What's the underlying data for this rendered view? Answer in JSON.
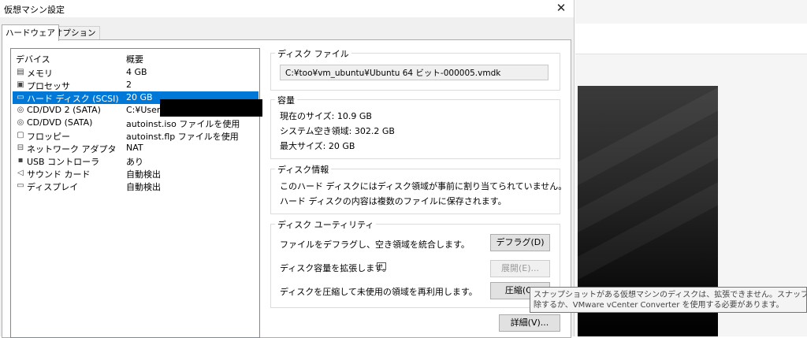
{
  "window": {
    "title": "仮想マシン設定",
    "close_icon": "close-icon"
  },
  "tabs": [
    {
      "label": "ハードウェア",
      "active": true
    },
    {
      "label": "オプション",
      "active": false
    }
  ],
  "device_list": {
    "col_device": "デバイス",
    "col_summary": "概要",
    "rows": [
      {
        "icon": "memory-icon",
        "name": "メモリ",
        "summary": "4 GB"
      },
      {
        "icon": "processor-icon",
        "name": "プロセッサ",
        "summary": "2"
      },
      {
        "icon": "hard-disk-icon",
        "name": "ハード ディスク (SCSI)",
        "summary": "20 GB",
        "selected": true
      },
      {
        "icon": "cd-dvd-icon",
        "name": "CD/DVD 2 (SATA)",
        "summary": "C:¥Users¥"
      },
      {
        "icon": "cd-dvd-icon",
        "name": "CD/DVD (SATA)",
        "summary": "autoinst.iso ファイルを使用"
      },
      {
        "icon": "floppy-icon",
        "name": "フロッピー",
        "summary": "autoinst.flp ファイルを使用"
      },
      {
        "icon": "network-adapter-icon",
        "name": "ネットワーク アダプタ",
        "summary": "NAT"
      },
      {
        "icon": "usb-icon",
        "name": "USB コントローラ",
        "summary": "あり"
      },
      {
        "icon": "sound-card-icon",
        "name": "サウンド カード",
        "summary": "自動検出"
      },
      {
        "icon": "display-icon",
        "name": "ディスプレイ",
        "summary": "自動検出"
      }
    ]
  },
  "disk_file": {
    "title": "ディスク ファイル",
    "path": "C:¥too¥vm_ubuntu¥Ubuntu 64 ビット-000005.vmdk"
  },
  "capacity": {
    "title": "容量",
    "current": "現在のサイズ: 10.9 GB",
    "free": "システム空き領域: 302.2 GB",
    "max": "最大サイズ: 20 GB"
  },
  "disk_info": {
    "title": "ディスク情報",
    "line1": "このハード ディスクにはディスク領域が事前に割り当てられていません。",
    "line2": "ハード ディスクの内容は複数のファイルに保存されます。"
  },
  "utility": {
    "title": "ディスク ユーティリティ",
    "defrag_text": "ファイルをデフラグし、空き領域を統合します。",
    "defrag_button": "デフラグ(D)",
    "expand_text": "ディスク容量を拡張します。",
    "expand_button": "展開(E)...",
    "compact_text": "ディスクを圧縮して未使用の領域を再利用します。",
    "compact_button": "圧縮(C)"
  },
  "details_button": "詳細(V)...",
  "tooltip": {
    "line1": "スナップショットがある仮想マシンのディスクは、拡張できません。スナップショットを削",
    "line2": "除するか、VMware vCenter Converter を使用する必要があります。"
  },
  "colors": {
    "selection": "#0078d7",
    "dialog_bg": "#f0f0f0"
  }
}
